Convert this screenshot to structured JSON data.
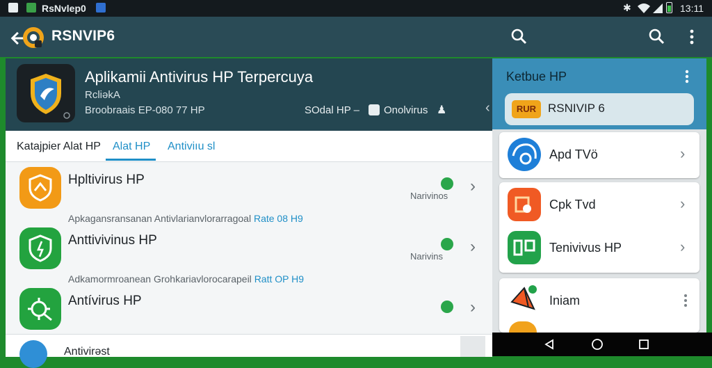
{
  "status_bar": {
    "app_name": "RsNvlep0",
    "time": "13:11"
  },
  "toolbar": {
    "title": "RSNVIP6",
    "back_icon": "arrow-left-icon",
    "search_icon": "search-icon",
    "overflow_icon": "more-vert-icon"
  },
  "app_header": {
    "title": "Aplikamii Antivirus HP Terpercuya",
    "subtitle": "RcliəkA",
    "meta": "Broobraais EP-080 77 HP",
    "developer": "SOdal HP  –",
    "category": "Onolvirus"
  },
  "tabs": [
    {
      "label": "Katajpier Alat HP"
    },
    {
      "label": "Alat HP"
    },
    {
      "label": "Antiviıu sl"
    }
  ],
  "list": [
    {
      "title": "Hpltivirus HP",
      "meta": "Narivinos",
      "sub": "Apkagansransanan  Antivlarianvlorarragoal",
      "sub_accent": "Rate 08 H9",
      "icon_color": "#f29a16"
    },
    {
      "title": "Anttivivinus HP",
      "meta": "Narivins",
      "sub": "Adkamormroanean  Grohkariavlorocarapeil",
      "sub_accent": "Ratt OP H9",
      "icon_color": "#23a33f"
    },
    {
      "title": "Antívirus HP",
      "meta": "",
      "sub": "",
      "sub_accent": "",
      "icon_color": "#23a33f"
    },
    {
      "title": "Antivirəst",
      "meta": "",
      "sub": "",
      "sub_accent": "",
      "icon_color": "#2f8fd6"
    }
  ],
  "right_panel": {
    "header_title": "Ketbue HP",
    "selected": {
      "badge": "RUR",
      "label": "RSNIVIP 6"
    },
    "items": [
      {
        "label": "Apd TVö",
        "icon_color": "#1e7fd8"
      },
      {
        "label": "Cpk Tvd",
        "icon_color": "#f05a24"
      },
      {
        "label": "Tenivivus HP",
        "icon_color": "#22a24a"
      },
      {
        "label": "Iniam",
        "icon_color": "#f1a21c"
      }
    ]
  }
}
